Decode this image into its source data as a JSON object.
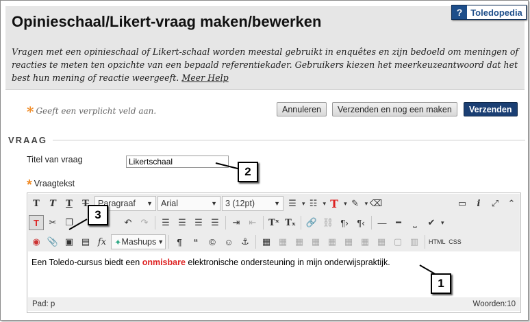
{
  "header": {
    "title": "Opinieschaal/Likert-vraag maken/bewerken",
    "help_badge": {
      "q": "?",
      "label": "Toledopedia"
    },
    "intro": "Vragen met een opinieschaal of Likert-schaal worden meestal gebruikt in enquêtes en zijn bedoeld om meningen of reacties te meten ten opzichte van een bepaald referentiekader. Gebruikers kiezen het meerkeuzeantwoord dat het best hun mening of reactie weergeeft.",
    "help_link": "Meer Help"
  },
  "form": {
    "required_note": "Geeft een verplicht veld aan.",
    "buttons": {
      "cancel": "Annuleren",
      "submit_new": "Verzenden en nog een maken",
      "submit": "Verzenden"
    },
    "section_title": "VRAAG",
    "title_label": "Titel van vraag",
    "title_value": "Likertschaal",
    "question_label": "Vraagtekst"
  },
  "editor": {
    "toolbar": {
      "paragraph": "Paragraaf",
      "font": "Arial",
      "size": "3 (12pt)",
      "mashups": "Mashups",
      "html": "HTML",
      "css": "CSS"
    },
    "content": {
      "before": "Een Toledo-cursus biedt een ",
      "highlight": "onmisbare",
      "after": " elektronische ondersteuning in mijn onderwijspraktijk."
    },
    "status_path": "Pad: p",
    "word_count": "Woorden:10"
  },
  "callouts": [
    "1",
    "2",
    "3"
  ],
  "colors": {
    "header_bg": "#e6e6e6",
    "primary_button": "#1b3f73",
    "required_star": "#f08a24",
    "highlight_text": "#dd2222",
    "badge": "#1d4e8a"
  }
}
